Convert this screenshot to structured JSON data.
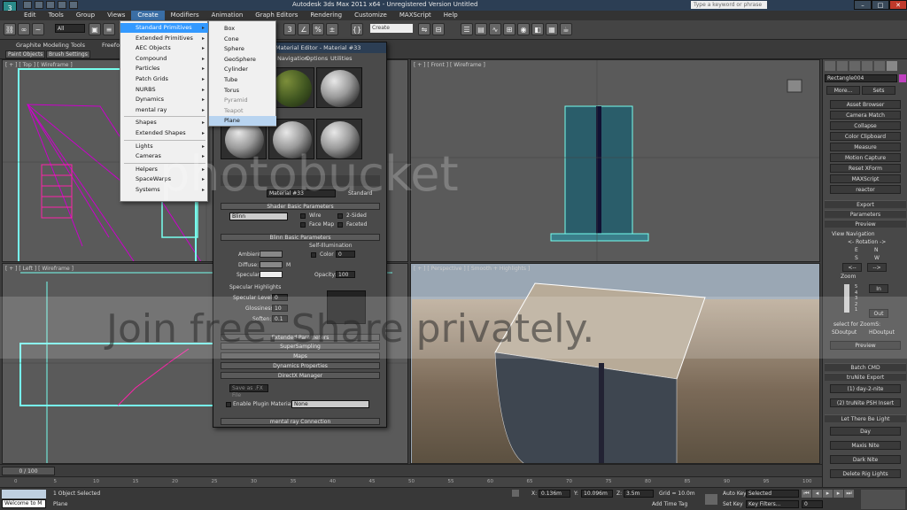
{
  "app": {
    "icon": "3ds-max-icon",
    "title": "Autodesk 3ds Max 2011 x64 - Unregistered Version  Untitled",
    "search_placeholder": "Type a keyword or phrase"
  },
  "menubar": [
    "Edit",
    "Tools",
    "Group",
    "Views",
    "Create",
    "Modifiers",
    "Animation",
    "Graph Editors",
    "Rendering",
    "Customize",
    "MAXScript",
    "Help"
  ],
  "toolbar": {
    "selection_filter": "All",
    "named_selection": "Create Selection S"
  },
  "ribbon": {
    "title": "Graphite Modeling Tools",
    "freeform": "Freefor",
    "tabs": [
      "Paint Objects",
      "Brush Settings"
    ]
  },
  "viewports": {
    "top": "[ + ] [ Top ] [ Wireframe ]",
    "front": "[ + ] [ Front ] [ Wireframe ]",
    "left": "[ + ] [ Left ] [ Wireframe ]",
    "perspective": "[ + ] [ Perspective ] [ Smooth + Highlights ]"
  },
  "create_menu": {
    "items": [
      {
        "label": "Standard Primitives",
        "sub": true,
        "active": true
      },
      {
        "label": "Extended Primitives",
        "sub": true
      },
      {
        "label": "AEC Objects",
        "sub": true
      },
      {
        "label": "Compound",
        "sub": true
      },
      {
        "label": "Particles",
        "sub": true
      },
      {
        "label": "Patch Grids",
        "sub": true
      },
      {
        "label": "NURBS",
        "sub": true
      },
      {
        "label": "Dynamics",
        "sub": true
      },
      {
        "label": "mental ray",
        "sub": true
      },
      {
        "label": "Shapes",
        "sub": true
      },
      {
        "label": "Extended Shapes",
        "sub": true
      },
      {
        "label": "Lights",
        "sub": true
      },
      {
        "label": "Cameras",
        "sub": true
      },
      {
        "label": "Helpers",
        "sub": true
      },
      {
        "label": "SpaceWarps",
        "sub": true
      },
      {
        "label": "Systems",
        "sub": true
      }
    ]
  },
  "primitives_menu": {
    "items": [
      "Box",
      "Cone",
      "Sphere",
      "GeoSphere",
      "Cylinder",
      "Tube",
      "Torus",
      "Pyramid",
      "Teapot",
      "Plane"
    ]
  },
  "material_editor": {
    "title": "Material Editor - Material #33",
    "menus": [
      "Navigation",
      "Options",
      "Utilities"
    ],
    "material_name": "Material #33",
    "material_type": "Standard",
    "shader_basic": {
      "header": "Shader Basic Parameters",
      "shader": "Blinn",
      "wire": "Wire",
      "two_sided": "2-Sided",
      "face_map": "Face Map",
      "faceted": "Faceted"
    },
    "blinn_basic": {
      "header": "Blinn Basic Parameters",
      "self_illum": "Self-Illumination",
      "color_label": "Color",
      "color_value": "0",
      "ambient": "Ambient:",
      "diffuse": "Diffuse:",
      "specular": "Specular:",
      "opacity_label": "Opacity:",
      "opacity_value": "100",
      "m": "M"
    },
    "spec": {
      "header": "Specular Highlights",
      "level_label": "Specular Level:",
      "level": "0",
      "gloss_label": "Glossiness:",
      "gloss": "10",
      "soften_label": "Soften:",
      "soften": "0.1"
    },
    "rollouts": [
      "Extended Parameters",
      "SuperSampling",
      "Maps",
      "Dynamics Properties",
      "DirectX Manager"
    ],
    "save_fx": "Save as .FX File",
    "enable_plugin": "Enable Plugin Material",
    "plugin_value": "None",
    "mental_ray": "mental ray Connection"
  },
  "command_panel": {
    "object_name": "Rectangle004",
    "more": "More...",
    "sets": "Sets",
    "utilities": [
      "Asset Browser",
      "Camera Match",
      "Collapse",
      "Color Clipboard",
      "Measure",
      "Motion Capture",
      "Reset XForm",
      "MAXScript",
      "reactor"
    ],
    "rollouts": {
      "export": "Export",
      "parameters": "Parameters",
      "preview": "Preview"
    },
    "view_nav": {
      "title": "View Navigation",
      "rotation": "<- Rotation ->",
      "e": "E",
      "n": "N",
      "s": "S",
      "w": "W",
      "left": "<--",
      "right": "-->",
      "zoom": "Zoom",
      "in": "In",
      "out": "Out",
      "zoom_levels": [
        "5",
        "4",
        "3",
        "2",
        "1"
      ],
      "select_for": "select for ZoomS:",
      "sd_output": "SDoutput",
      "hd_output": "HDoutput",
      "preview_btn": "Preview"
    },
    "batch_cmd": "Batch CMD",
    "trunite_export": "truNite Export",
    "day2nite": "(1) day-2-nite",
    "trunite_psh": "(2) truNite PSH Insert",
    "let_light": "Let There Be Light",
    "light_buttons": [
      "Day",
      "Maxis Nite",
      "Dark Nite",
      "Delete Rig Lights"
    ]
  },
  "timeline": {
    "frame": "0 / 100",
    "ticks": [
      "0",
      "5",
      "10",
      "15",
      "20",
      "25",
      "30",
      "35",
      "40",
      "45",
      "50",
      "55",
      "60",
      "65",
      "70",
      "75",
      "80",
      "85",
      "90",
      "95",
      "100"
    ]
  },
  "status": {
    "maxscript": "Welcome to M",
    "selection": "1 Object Selected",
    "prompt": "Plane",
    "x_label": "X:",
    "x": "0.136m",
    "y_label": "Y:",
    "y": "10.096m",
    "z_label": "Z:",
    "z": "3.5m",
    "grid": "Grid = 10.0m",
    "add_time_tag": "Add Time Tag",
    "auto_key": "Auto Key",
    "selected": "Selected",
    "set_key": "Set Key",
    "key_filters": "Key Filters...",
    "frame_value": "0"
  },
  "watermark": {
    "brand": "photobucket",
    "tagline": "Join free. Share privately."
  }
}
